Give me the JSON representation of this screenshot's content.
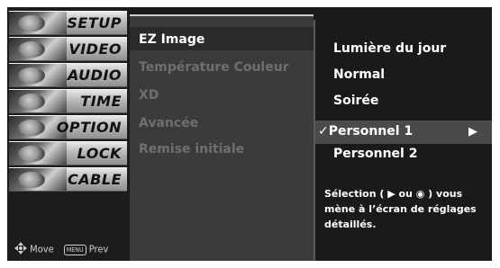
{
  "categories": [
    {
      "label": "SETUP"
    },
    {
      "label": "VIDEO"
    },
    {
      "label": "AUDIO"
    },
    {
      "label": "TIME"
    },
    {
      "label": "OPTION"
    },
    {
      "label": "LOCK"
    },
    {
      "label": "CABLE"
    }
  ],
  "submenu": {
    "items": [
      {
        "label": "EZ Image",
        "active": true
      },
      {
        "label": "Température Couleur"
      },
      {
        "label": "XD"
      },
      {
        "label": "Avancée"
      },
      {
        "label": "Remise initiale"
      }
    ]
  },
  "options": {
    "items": [
      {
        "label": "Lumière du jour"
      },
      {
        "label": "Normal"
      },
      {
        "label": "Soirée"
      },
      {
        "label": "✓Personnel 1",
        "selected": true
      },
      {
        "label": "Personnel 2"
      }
    ],
    "selected_arrow": "▶",
    "help_text": "Sélection ( ▶ ou ◉ ) vous mène à l’écran de réglages détaillés."
  },
  "footer": {
    "move_label": "Move",
    "menu_key_label": "MENU",
    "prev_label": "Prev"
  }
}
